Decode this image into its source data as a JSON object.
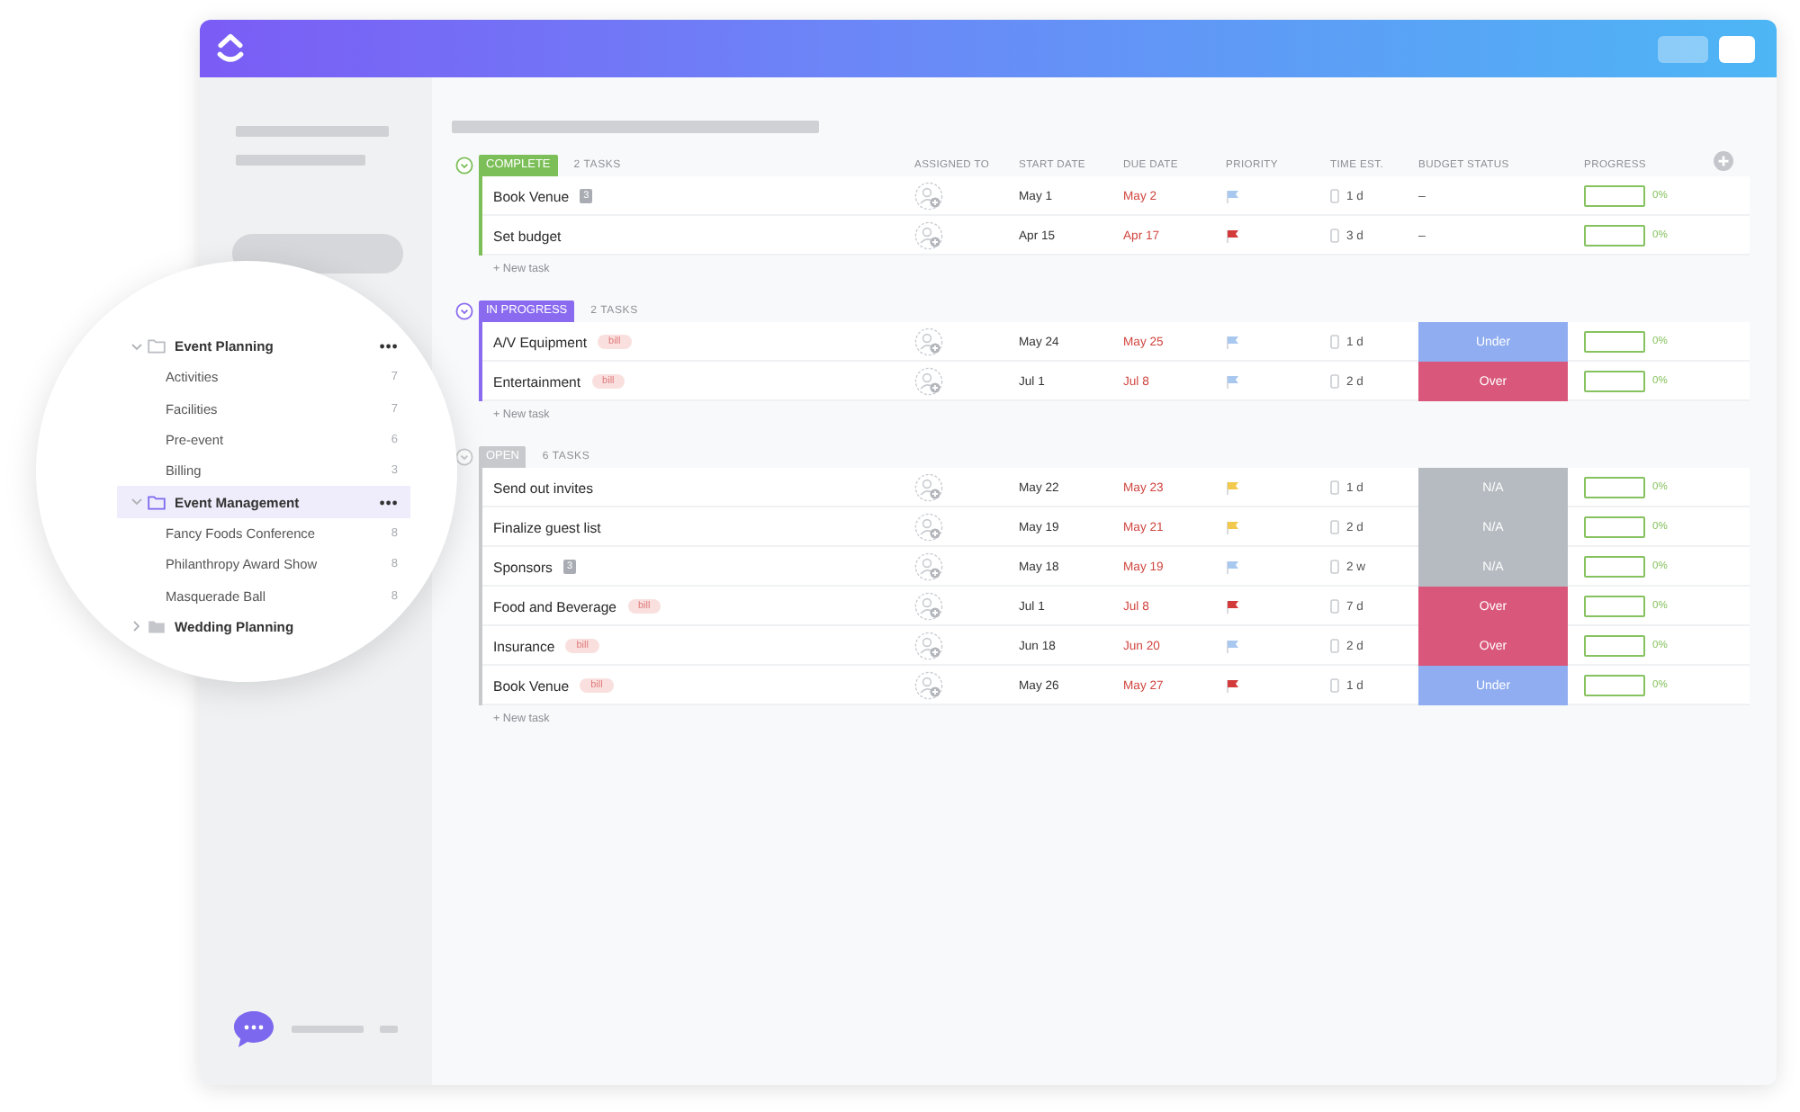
{
  "columns": [
    "ASSIGNED TO",
    "START DATE",
    "DUE DATE",
    "PRIORITY",
    "TIME EST.",
    "BUDGET STATUS",
    "PROGRESS"
  ],
  "groups": [
    {
      "status": "COMPLETE",
      "kind": "complete",
      "count": "2 TASKS",
      "new_task": "+ New task",
      "tasks": [
        {
          "name": "Book Venue",
          "tag": {
            "kind": "count",
            "text": "3"
          },
          "start": "May 1",
          "due": "May 2",
          "flag": {
            "color": "#a9c8f0"
          },
          "time": "1 d",
          "budget": {
            "kind": "none",
            "text": "–"
          },
          "progress": {
            "level": 0,
            "text": "0%"
          }
        },
        {
          "name": "Set budget",
          "start": "Apr 15",
          "due": "Apr 17",
          "flag": {
            "color": "#d33a3a"
          },
          "time": "3 d",
          "budget": {
            "kind": "none",
            "text": "–"
          },
          "progress": {
            "level": 0,
            "text": "0%"
          }
        }
      ]
    },
    {
      "status": "IN PROGRESS",
      "kind": "in_progress",
      "count": "2 TASKS",
      "new_task": "+ New task",
      "tasks": [
        {
          "name": "A/V Equipment",
          "tag": {
            "kind": "label",
            "text": "bill"
          },
          "start": "May 24",
          "due": "May 25",
          "flag": {
            "color": "#a9c8f0"
          },
          "time": "1 d",
          "budget": {
            "kind": "under",
            "text": "Under"
          },
          "progress": {
            "level": 0,
            "text": "0%"
          }
        },
        {
          "name": "Entertainment",
          "tag": {
            "kind": "label",
            "text": "bill"
          },
          "start": "Jul 1",
          "due": "Jul 8",
          "flag": {
            "color": "#a9c8f0"
          },
          "time": "2 d",
          "budget": {
            "kind": "over",
            "text": "Over"
          },
          "progress": {
            "level": 0,
            "text": "0%"
          }
        }
      ]
    },
    {
      "status": "OPEN",
      "kind": "open",
      "count": "6 TASKS",
      "new_task": "+ New task",
      "tasks": [
        {
          "name": "Send out invites",
          "start": "May 22",
          "due": "May 23",
          "flag": {
            "color": "#f2c94c"
          },
          "time": "1 d",
          "budget": {
            "kind": "na",
            "text": "N/A"
          },
          "progress": {
            "level": 0,
            "text": "0%"
          }
        },
        {
          "name": "Finalize guest list",
          "start": "May 19",
          "due": "May 21",
          "flag": {
            "color": "#f2c94c"
          },
          "time": "2 d",
          "budget": {
            "kind": "na",
            "text": "N/A"
          },
          "progress": {
            "level": 0,
            "text": "0%"
          }
        },
        {
          "name": "Sponsors",
          "tag": {
            "kind": "count",
            "text": "3"
          },
          "start": "May 18",
          "due": "May 19",
          "flag": {
            "color": "#a9c8f0"
          },
          "time": "2 w",
          "budget": {
            "kind": "na",
            "text": "N/A"
          },
          "progress": {
            "level": 0,
            "text": "0%"
          }
        },
        {
          "name": "Food and Beverage",
          "tag": {
            "kind": "label",
            "text": "bill"
          },
          "start": "Jul 1",
          "due": "Jul 8",
          "flag": {
            "color": "#d33a3a"
          },
          "time": "7 d",
          "budget": {
            "kind": "over",
            "text": "Over"
          },
          "progress": {
            "level": 0,
            "text": "0%"
          }
        },
        {
          "name": "Insurance",
          "tag": {
            "kind": "label",
            "text": "bill"
          },
          "start": "Jun 18",
          "due": "Jun 20",
          "flag": {
            "color": "#a9c8f0"
          },
          "time": "2 d",
          "budget": {
            "kind": "over",
            "text": "Over"
          },
          "progress": {
            "level": 0,
            "text": "0%"
          }
        },
        {
          "name": "Book Venue",
          "tag": {
            "kind": "label",
            "text": "bill"
          },
          "start": "May 26",
          "due": "May 27",
          "flag": {
            "color": "#d33a3a"
          },
          "time": "1 d",
          "budget": {
            "kind": "under",
            "text": "Under"
          },
          "progress": {
            "level": 0,
            "text": "0%"
          }
        }
      ]
    }
  ],
  "sidebar": {
    "folders": [
      {
        "name": "Event Planning",
        "expanded": true,
        "selected": false,
        "menu": true,
        "children": [
          {
            "name": "Activities",
            "count": "7"
          },
          {
            "name": "Facilities",
            "count": "7"
          },
          {
            "name": "Pre-event",
            "count": "6"
          },
          {
            "name": "Billing",
            "count": "3"
          }
        ]
      },
      {
        "name": "Event Management",
        "expanded": true,
        "selected": true,
        "menu": true,
        "children": [
          {
            "name": "Fancy Foods Conference",
            "count": "8"
          },
          {
            "name": "Philanthropy Award Show",
            "count": "8"
          },
          {
            "name": "Masquerade Ball",
            "count": "8"
          }
        ]
      },
      {
        "name": "Wedding Planning",
        "expanded": false,
        "selected": false,
        "menu": false
      }
    ]
  }
}
